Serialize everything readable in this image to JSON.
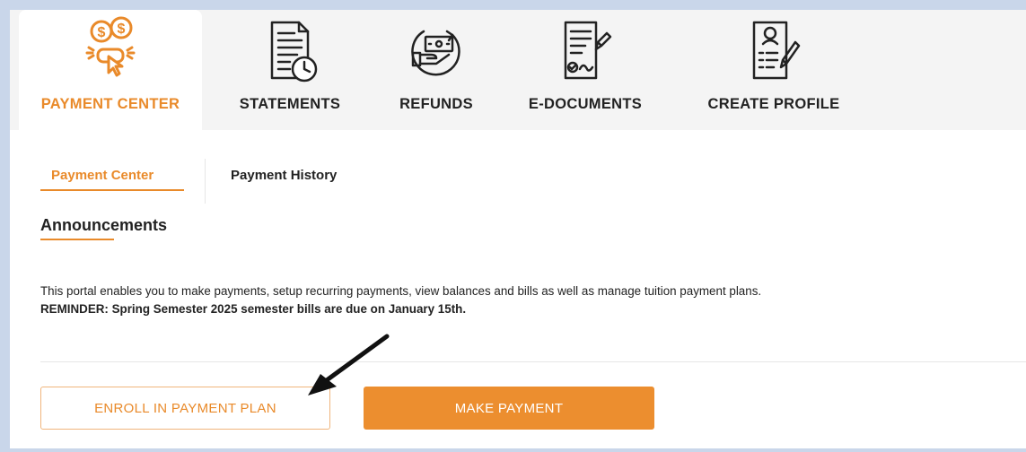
{
  "top_nav": {
    "items": [
      {
        "label": "PAYMENT CENTER",
        "icon": "payment-center-icon",
        "active": true
      },
      {
        "label": "STATEMENTS",
        "icon": "statements-icon",
        "active": false
      },
      {
        "label": "REFUNDS",
        "icon": "refunds-icon",
        "active": false
      },
      {
        "label": "E-DOCUMENTS",
        "icon": "e-documents-icon",
        "active": false
      },
      {
        "label": "CREATE PROFILE",
        "icon": "create-profile-icon",
        "active": false
      }
    ]
  },
  "sub_tabs": {
    "items": [
      {
        "label": "Payment Center",
        "active": true
      },
      {
        "label": "Payment History",
        "active": false
      }
    ]
  },
  "announcements": {
    "title": "Announcements",
    "text": "This portal enables you to make payments, setup recurring payments, view balances and bills as well as manage tuition payment plans.",
    "reminder": "REMINDER: Spring Semester 2025 semester bills are due on January 15th."
  },
  "actions": {
    "enroll_label": "ENROLL IN PAYMENT PLAN",
    "make_payment_label": "MAKE PAYMENT"
  },
  "colors": {
    "accent": "#e98a2a",
    "nav_background": "#f4f4f4",
    "page_border": "#c9d6ea"
  }
}
